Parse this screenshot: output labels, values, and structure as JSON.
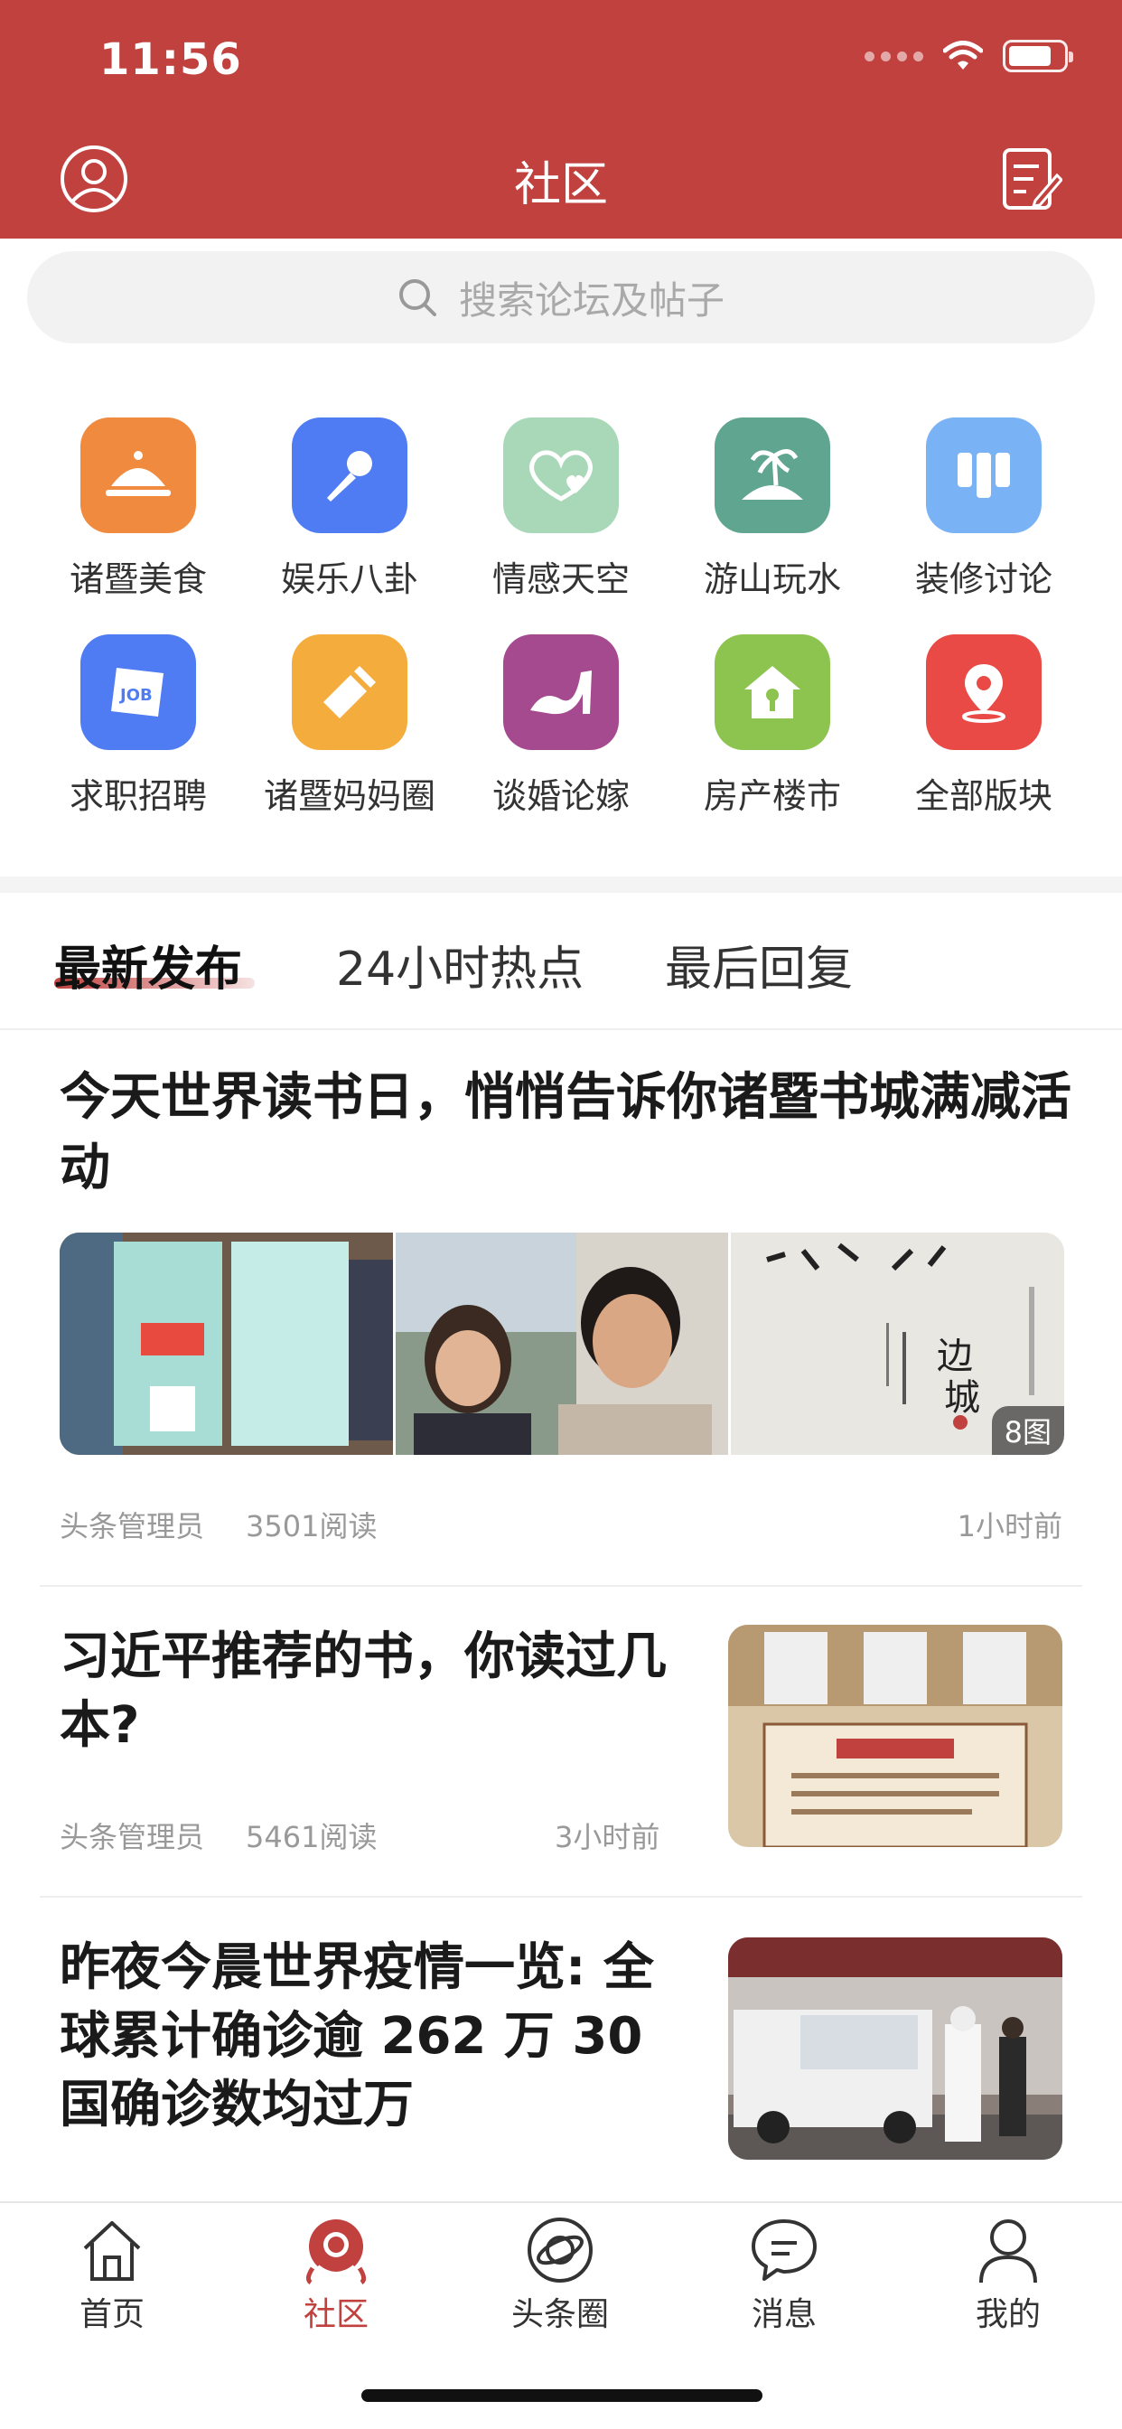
{
  "status_bar": {
    "time": "11:56"
  },
  "header": {
    "title": "社区"
  },
  "search": {
    "placeholder": "搜索论坛及帖子"
  },
  "categories": [
    {
      "label": "诸暨美食",
      "icon": "food-cloche-icon",
      "color": "#f08a3e"
    },
    {
      "label": "娱乐八卦",
      "icon": "microphone-icon",
      "color": "#4f7cf2"
    },
    {
      "label": "情感天空",
      "icon": "hearts-icon",
      "color": "#a8d8b8"
    },
    {
      "label": "游山玩水",
      "icon": "palm-island-icon",
      "color": "#5fa58f"
    },
    {
      "label": "装修讨论",
      "icon": "wallpaper-rolls-icon",
      "color": "#7ab3f5"
    },
    {
      "label": "求职招聘",
      "icon": "job-sign-icon",
      "color": "#4f7cf2"
    },
    {
      "label": "诸暨妈妈圈",
      "icon": "baby-bottle-icon",
      "color": "#f4ad3d"
    },
    {
      "label": "谈婚论嫁",
      "icon": "high-heel-icon",
      "color": "#a54a8f"
    },
    {
      "label": "房产楼市",
      "icon": "house-icon",
      "color": "#8cc44f"
    },
    {
      "label": "全部版块",
      "icon": "location-pin-icon",
      "color": "#e94a46"
    }
  ],
  "tabs": [
    {
      "label": "最新发布"
    },
    {
      "label": "24小时热点"
    },
    {
      "label": "最后回复"
    }
  ],
  "posts": [
    {
      "title": "今天世界读书日，悄悄告诉你诸暨书城满减活动",
      "author": "头条管理员",
      "reads": "3501阅读",
      "time": "1小时前",
      "image_count": "8图"
    },
    {
      "title": "习近平推荐的书，你读过几本?",
      "author": "头条管理员",
      "reads": "5461阅读",
      "time": "3小时前"
    },
    {
      "title": "昨夜今晨世界疫情一览: 全球累计确诊逾 262 万 30 国确诊数均过万"
    }
  ],
  "bottom_nav": [
    {
      "label": "首页",
      "icon": "home-icon"
    },
    {
      "label": "社区",
      "icon": "community-icon"
    },
    {
      "label": "头条圈",
      "icon": "circle-planet-icon"
    },
    {
      "label": "消息",
      "icon": "chat-bubble-icon"
    },
    {
      "label": "我的",
      "icon": "user-icon"
    }
  ],
  "colors": {
    "brand": "#c1413f",
    "muted_text": "#999999"
  }
}
